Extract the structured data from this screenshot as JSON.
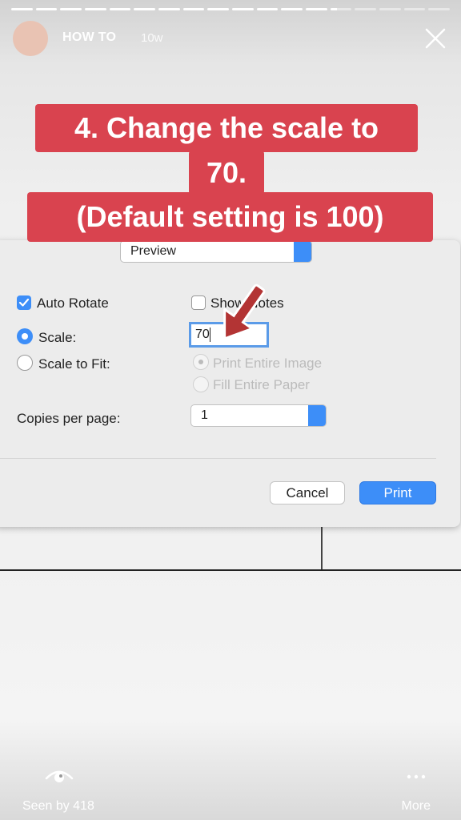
{
  "story": {
    "username": "HOW TO",
    "time_ago": "10w",
    "segments_filled": [
      1,
      1,
      1,
      1,
      1,
      1,
      1,
      1,
      1,
      1,
      1,
      1,
      1,
      0.3,
      0,
      0,
      0,
      0
    ]
  },
  "caption": {
    "line1": "4. Change the scale to",
    "line2": "70.",
    "line3": "(Default setting is 100)"
  },
  "dialog": {
    "popup_value": "Preview",
    "auto_rotate_label": "Auto Rotate",
    "auto_rotate_checked": true,
    "show_notes_label": "Show Notes",
    "show_notes_checked": false,
    "scale_label": "Scale:",
    "scale_value": "70",
    "scale_to_fit_label": "Scale to Fit:",
    "print_entire_image_label": "Print Entire Image",
    "fill_entire_paper_label": "Fill Entire Paper",
    "copies_label": "Copies per page:",
    "copies_value": "1",
    "cancel_label": "Cancel",
    "print_label": "Print"
  },
  "footer": {
    "seen_by": "Seen by 418",
    "more": "More"
  },
  "colors": {
    "caption_bg": "#d9434f",
    "accent_blue": "#3d8ef8",
    "arrow": "#b33434"
  }
}
